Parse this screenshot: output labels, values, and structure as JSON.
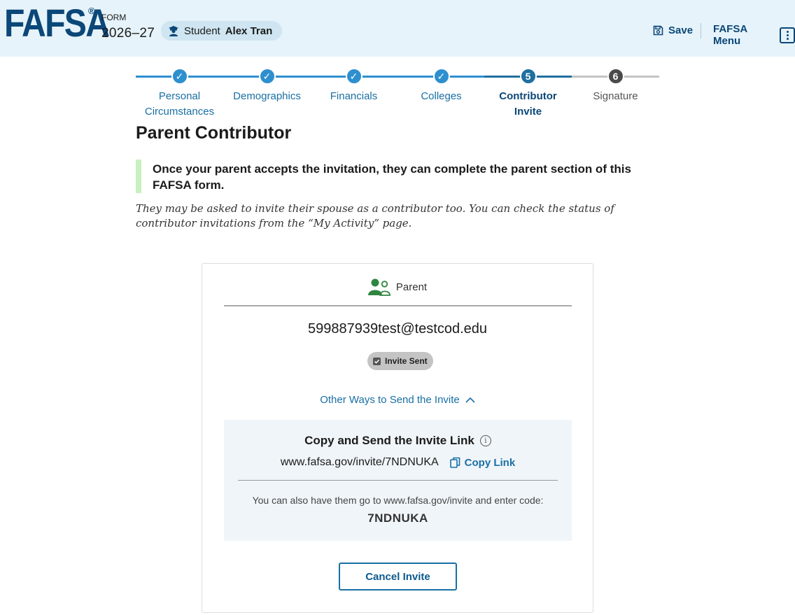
{
  "header": {
    "logo_text": "FAFSA",
    "logo_reg": "®",
    "form_label": "FORM",
    "form_year": "2026–27",
    "student_prefix": "Student",
    "student_name": "Alex Tran",
    "save_label": "Save",
    "menu_label": "FAFSA Menu"
  },
  "stepper": {
    "steps": [
      {
        "label": "Personal Circumstances",
        "marker": "✓",
        "state": "done"
      },
      {
        "label": "Demographics",
        "marker": "✓",
        "state": "done"
      },
      {
        "label": "Financials",
        "marker": "✓",
        "state": "done"
      },
      {
        "label": "Colleges",
        "marker": "✓",
        "state": "done"
      },
      {
        "label": "Contributor Invite",
        "marker": "5",
        "state": "active"
      },
      {
        "label": "Signature",
        "marker": "6",
        "state": "future"
      }
    ]
  },
  "main": {
    "title": "Parent Contributor",
    "callout": "Once your parent accepts the invitation, they can complete the parent section of this FAFSA form.",
    "note": "They may be asked to invite their spouse as a contributor too. You can check the status of contributor invitations from the “My Activity” page."
  },
  "card": {
    "role_label": "Parent",
    "email": "599887939test@testcod.edu",
    "status_badge": "Invite Sent",
    "other_ways_label": "Other Ways to Send the Invite",
    "link_box": {
      "title": "Copy and Send the Invite Link",
      "info_glyph": "i",
      "invite_url": "www.fafsa.gov/invite/7NDNUKA",
      "copy_label": "Copy Link",
      "also_text": "You can also have them go to www.fafsa.gov/invite and enter code:",
      "code": "7NDNUKA"
    },
    "cancel_label": "Cancel Invite"
  },
  "colors": {
    "brand_dark": "#0b4778",
    "link_blue": "#1a6fa3",
    "step_done": "#2e8fcf",
    "step_active": "#1f6f9f",
    "step_future": "#4a4a4a",
    "header_bg": "#e6f3fa",
    "callout_border": "#c9f0bf",
    "parent_icon_green": "#2e8540"
  }
}
